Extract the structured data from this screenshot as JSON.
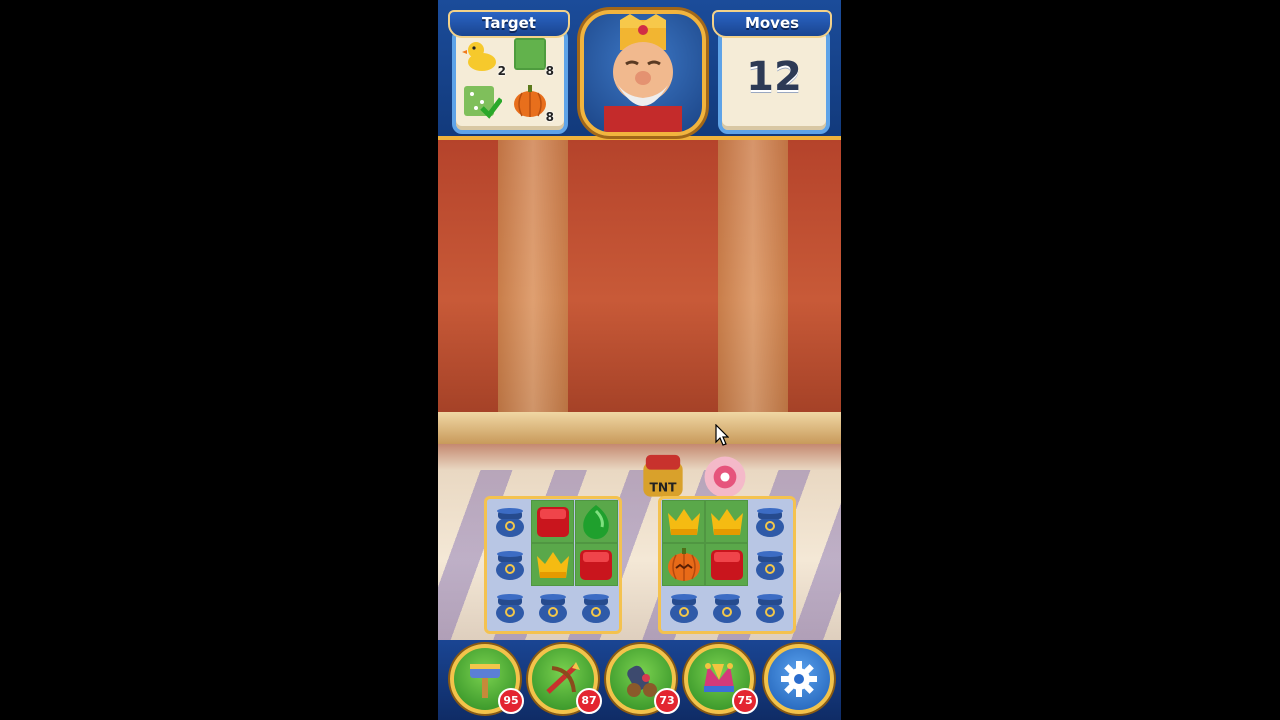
{
  "header": {
    "target_label": "Target",
    "moves_label": "Moves",
    "moves_count": "12",
    "targets": [
      {
        "icon": "duck-icon",
        "count": "2"
      },
      {
        "icon": "grass-icon",
        "count": "8"
      },
      {
        "icon": "grass-complete-icon",
        "count": ""
      },
      {
        "icon": "pumpkin-icon",
        "count": "8"
      }
    ],
    "avatar": "king-avatar"
  },
  "boosters": [
    {
      "name": "hammer-booster",
      "count": "95"
    },
    {
      "name": "arrow-booster",
      "count": "87"
    },
    {
      "name": "cannon-booster",
      "count": "73"
    },
    {
      "name": "jester-hat-booster",
      "count": "75"
    }
  ],
  "settings_icon": "gear-icon",
  "colors": {
    "header_bg": "#1b4c9a",
    "gold_border": "#f4c24f",
    "badge": "#e32530"
  }
}
